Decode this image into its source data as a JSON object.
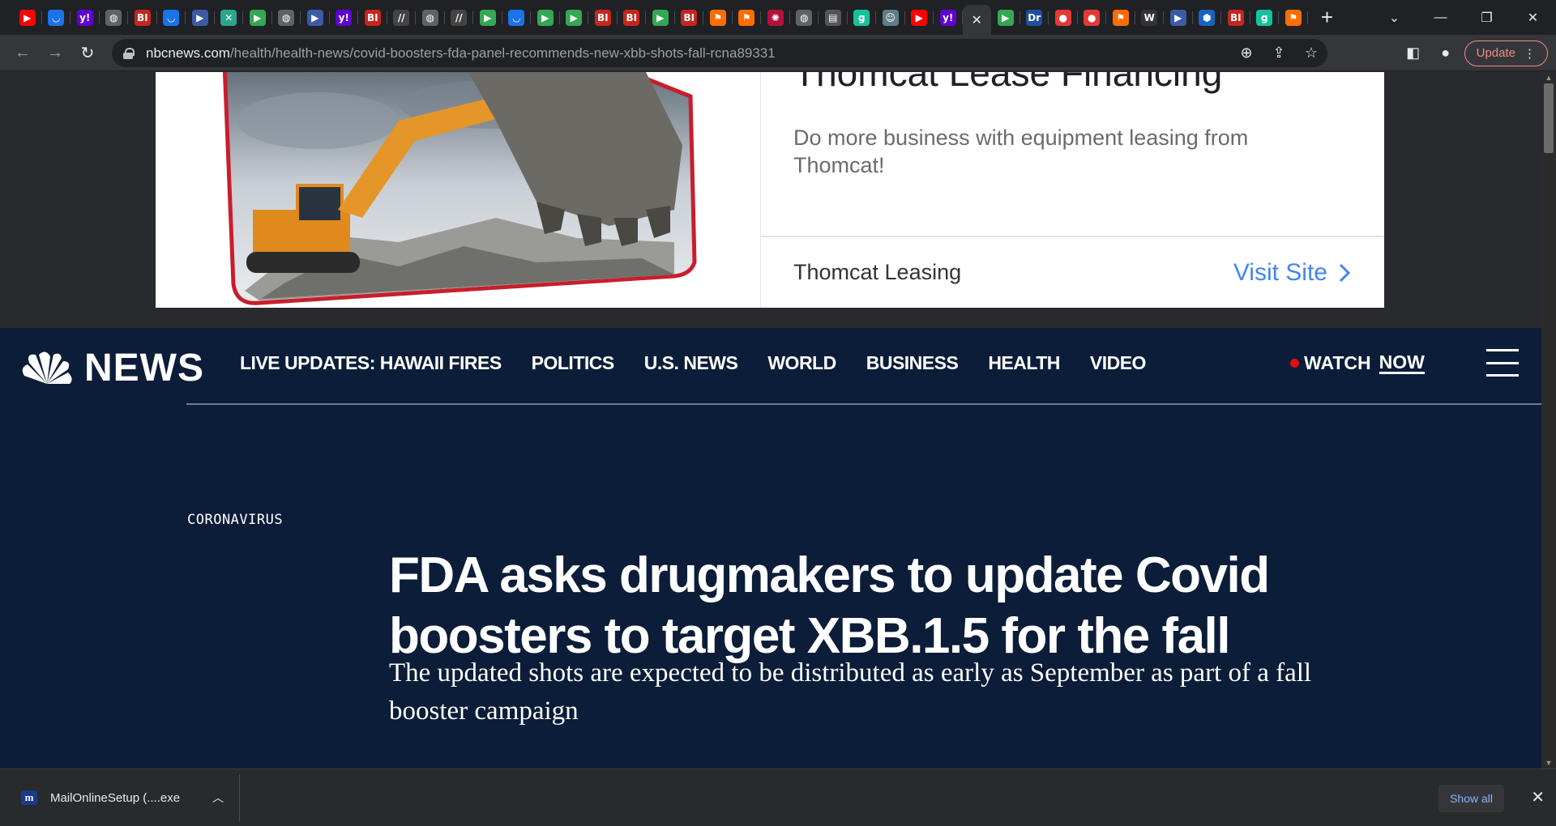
{
  "browser": {
    "tabs": [
      {
        "icon": "youtube-icon",
        "glyph": "▶",
        "color": "#ff0000"
      },
      {
        "icon": "shield-icon",
        "glyph": "◡",
        "color": "#1a73e8"
      },
      {
        "icon": "yahoo-icon",
        "glyph": "y!",
        "color": "#6001d2"
      },
      {
        "icon": "globe-icon",
        "glyph": "◍",
        "color": "#5f6368"
      },
      {
        "icon": "bi-icon",
        "glyph": "BI",
        "color": "#c4261d"
      },
      {
        "icon": "shield-icon",
        "glyph": "◡",
        "color": "#1a73e8"
      },
      {
        "icon": "flag-icon",
        "glyph": "▶",
        "color": "#3b5ba5"
      },
      {
        "icon": "grid-icon",
        "glyph": "✕",
        "color": "#2ca58d"
      },
      {
        "icon": "play-icon",
        "glyph": "▶",
        "color": "#34a853"
      },
      {
        "icon": "globe-icon",
        "glyph": "◍",
        "color": "#5f6368"
      },
      {
        "icon": "flag-icon",
        "glyph": "▶",
        "color": "#3b5ba5"
      },
      {
        "icon": "yahoo-icon",
        "glyph": "y!",
        "color": "#6001d2"
      },
      {
        "icon": "bi-icon",
        "glyph": "BI",
        "color": "#c4261d"
      },
      {
        "icon": "wsj-icon",
        "glyph": "//",
        "color": "#444444"
      },
      {
        "icon": "globe-icon",
        "glyph": "◍",
        "color": "#5f6368"
      },
      {
        "icon": "wsj-icon",
        "glyph": "//",
        "color": "#444444"
      },
      {
        "icon": "play-icon",
        "glyph": "▶",
        "color": "#34a853"
      },
      {
        "icon": "shield-icon",
        "glyph": "◡",
        "color": "#1a73e8"
      },
      {
        "icon": "play-icon",
        "glyph": "▶",
        "color": "#34a853"
      },
      {
        "icon": "play-icon",
        "glyph": "▶",
        "color": "#34a853"
      },
      {
        "icon": "bi-icon",
        "glyph": "BI",
        "color": "#c4261d"
      },
      {
        "icon": "bi-icon",
        "glyph": "BI",
        "color": "#c4261d"
      },
      {
        "icon": "play-icon",
        "glyph": "▶",
        "color": "#34a853"
      },
      {
        "icon": "bi-icon",
        "glyph": "BI",
        "color": "#c4261d"
      },
      {
        "icon": "bookmark-icon",
        "glyph": "⚑",
        "color": "#ff6d00"
      },
      {
        "icon": "bookmark-icon",
        "glyph": "⚑",
        "color": "#ff6d00"
      },
      {
        "icon": "burst-icon",
        "glyph": "✺",
        "color": "#b3133b"
      },
      {
        "icon": "globe-icon",
        "glyph": "◍",
        "color": "#5f6368"
      },
      {
        "icon": "news-icon",
        "glyph": "▤",
        "color": "#555555"
      },
      {
        "icon": "g-icon",
        "glyph": "g",
        "color": "#15c39a"
      },
      {
        "icon": "avatar-icon",
        "glyph": "☺",
        "color": "#607d8b"
      },
      {
        "icon": "youtube-icon",
        "glyph": "▶",
        "color": "#ff0000"
      },
      {
        "icon": "yahoo-icon",
        "glyph": "y!",
        "color": "#6001d2"
      },
      {
        "icon": "close-icon",
        "glyph": "✕",
        "color": "transparent",
        "active": true
      },
      {
        "icon": "play-icon",
        "glyph": "▶",
        "color": "#34a853"
      },
      {
        "icon": "dr-icon",
        "glyph": "Dr",
        "color": "#1e4fa1"
      },
      {
        "icon": "podcast-icon",
        "glyph": "●",
        "color": "#e53935"
      },
      {
        "icon": "podcast-icon",
        "glyph": "●",
        "color": "#e53935"
      },
      {
        "icon": "bookmark-icon",
        "glyph": "⚑",
        "color": "#ff6d00"
      },
      {
        "icon": "wapo-icon",
        "glyph": "W",
        "color": "#333333"
      },
      {
        "icon": "flag-icon",
        "glyph": "▶",
        "color": "#3b5ba5"
      },
      {
        "icon": "cube-icon",
        "glyph": "⬢",
        "color": "#1565c0"
      },
      {
        "icon": "bi-icon",
        "glyph": "BI",
        "color": "#c4261d"
      },
      {
        "icon": "g-icon",
        "glyph": "g",
        "color": "#15c39a"
      },
      {
        "icon": "bookmark-icon",
        "glyph": "⚑",
        "color": "#ff6d00"
      }
    ],
    "url_host": "nbcnews.com",
    "url_path": "/health/health-news/covid-boosters-fda-panel-recommends-new-xbb-shots-fall-rcna89331",
    "update_label": "Update"
  },
  "ad": {
    "headline": "Thomcat Lease Financing",
    "description": "Do more business with equipment leasing from Thomcat!",
    "advertiser": "Thomcat Leasing",
    "cta": "Visit Site"
  },
  "nbc": {
    "logo_text": "NEWS",
    "nav": [
      "LIVE UPDATES: HAWAII FIRES",
      "POLITICS",
      "U.S. NEWS",
      "WORLD",
      "BUSINESS",
      "HEALTH",
      "VIDEO"
    ],
    "watch_label": "WATCH",
    "watch_now": "NOW"
  },
  "article": {
    "eyebrow": "CORONAVIRUS",
    "headline": "FDA asks drugmakers to update Covid boosters to target XBB.1.5 for the fall",
    "dek": "The updated shots are expected to be distributed as early as September as part of a fall booster campaign"
  },
  "downloads": {
    "file_name": "MailOnlineSetup (....exe",
    "show_all": "Show all"
  },
  "colors": {
    "nbc_navy": "#0b1d38",
    "live_dot": "#e30b0b",
    "ad_cta": "#4285f4",
    "update_accent": "#f28b82"
  }
}
